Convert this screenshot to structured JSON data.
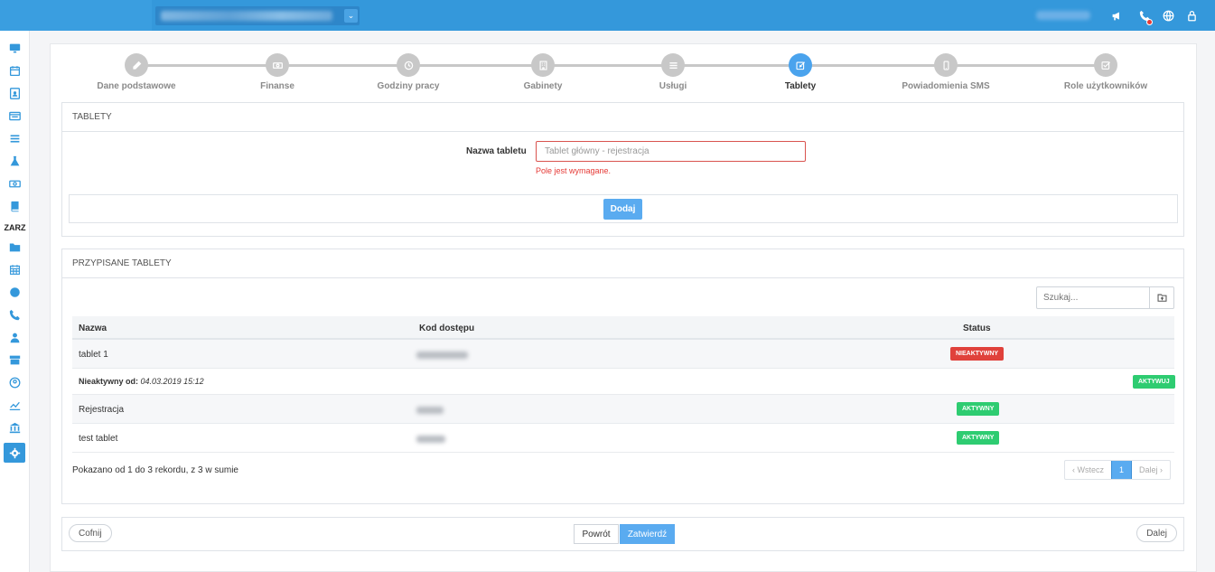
{
  "sidebar": {
    "section_label": "ZARZ",
    "icons": [
      "monitor-icon",
      "calendar-icon",
      "contact-icon",
      "card-list-icon",
      "list-icon",
      "flask-icon",
      "money-icon",
      "book-icon",
      "folder-icon",
      "calendar-grid-icon",
      "globe-icon",
      "phone-icon",
      "user-group-icon",
      "archive-icon",
      "user-circle-icon",
      "chart-line-icon",
      "bank-icon",
      "gear-icon"
    ]
  },
  "wizard": {
    "steps": [
      {
        "label": "Dane podstawowe",
        "icon": "pencil-icon"
      },
      {
        "label": "Finanse",
        "icon": "money-icon"
      },
      {
        "label": "Godziny pracy",
        "icon": "clock-icon"
      },
      {
        "label": "Gabinety",
        "icon": "building-icon"
      },
      {
        "label": "Usługi",
        "icon": "list-icon"
      },
      {
        "label": "Tablety",
        "icon": "edit-icon"
      },
      {
        "label": "Powiadomienia SMS",
        "icon": "mobile-icon"
      },
      {
        "label": "Role użytkowników",
        "icon": "check-square-icon"
      }
    ],
    "active_index": 5
  },
  "tablet_form": {
    "header": "TABLETY",
    "label": "Nazwa tabletu",
    "placeholder": "Tablet główny - rejestracja",
    "value": "",
    "error": "Pole jest wymagane.",
    "add_button": "Dodaj"
  },
  "assigned": {
    "header": "PRZYPISANE TABLETY",
    "search_placeholder": "Szukaj...",
    "columns": [
      "Nazwa",
      "Kod dostępu",
      "Status"
    ],
    "rows": [
      {
        "name": "tablet 1",
        "status": "NIEAKTYWNY",
        "status_color": "#e0413b",
        "detail_label": "Nieaktywny od:",
        "detail_value": "04.03.2019 15:12",
        "detail_action": "AKTYWUJ"
      },
      {
        "name": "Rejestracja",
        "status": "AKTYWNY",
        "status_color": "#2ecc71"
      },
      {
        "name": "test tablet",
        "status": "AKTYWNY",
        "status_color": "#2ecc71"
      }
    ],
    "info": "Pokazano od 1 do 3 rekordu, z 3 w sumie",
    "pager": {
      "prev": "‹ Wstecz",
      "current": "1",
      "next": "Dalej ›"
    }
  },
  "bottom": {
    "back_round": "Cofnij",
    "back": "Powrót",
    "confirm": "Zatwierdź",
    "next_round": "Dalej"
  },
  "colors": {
    "accent": "#3498db",
    "danger": "#e0413b",
    "success": "#2ecc71"
  }
}
